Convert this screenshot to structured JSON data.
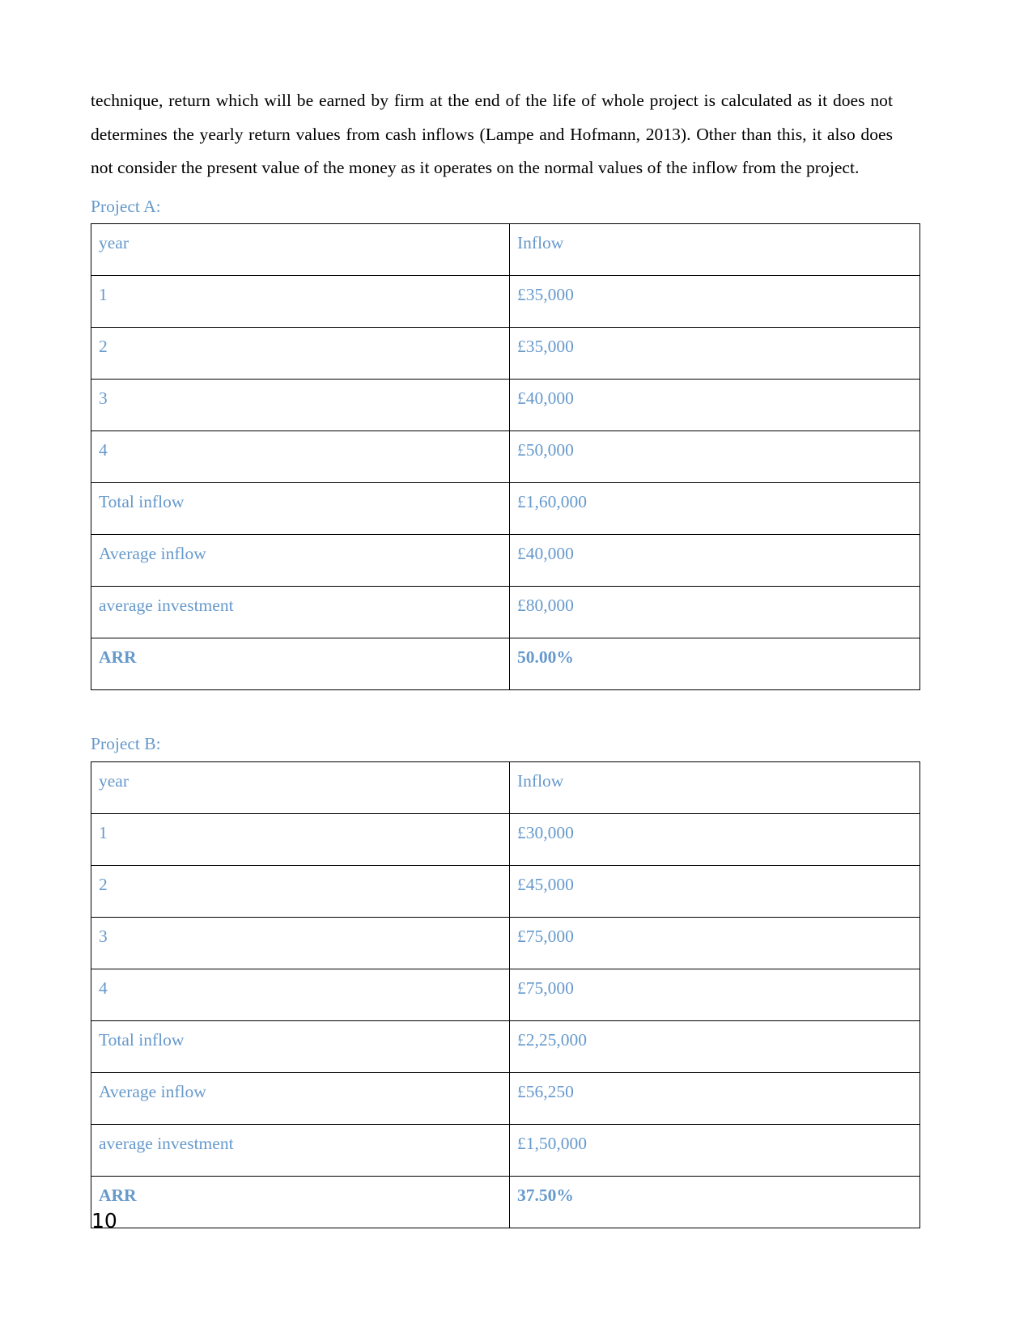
{
  "document": {
    "page_number": "10",
    "accent_color": "#6699cc",
    "body_text_color": "#000000",
    "paragraph": "technique, return which will be earned by firm at the end of the life of whole project is calculated as it does not determines the yearly return values from cash inflows (Lampe and Hofmann, 2013). Other than this, it also does not consider the present value of the money as it operates on the normal values of the inflow from the project."
  },
  "project_a": {
    "caption": "Project A:",
    "table": {
      "columns": [
        "year",
        "Inflow"
      ],
      "rows": [
        {
          "label": "1",
          "value": "£35,000",
          "emphasis": false
        },
        {
          "label": "2",
          "value": "£35,000",
          "emphasis": false
        },
        {
          "label": "3",
          "value": "£40,000",
          "emphasis": false
        },
        {
          "label": "4",
          "value": "£50,000",
          "emphasis": false
        },
        {
          "label": "Total inflow",
          "value": "£1,60,000",
          "emphasis": false
        },
        {
          "label": "Average inflow",
          "value": "£40,000",
          "emphasis": false
        },
        {
          "label": "average investment",
          "value": "£80,000",
          "emphasis": false
        },
        {
          "label": "ARR",
          "value": "50.00%",
          "emphasis": true
        }
      ]
    }
  },
  "project_b": {
    "caption": "Project B:",
    "table": {
      "columns": [
        "year",
        "Inflow"
      ],
      "rows": [
        {
          "label": "1",
          "value": "£30,000",
          "emphasis": false
        },
        {
          "label": "2",
          "value": "£45,000",
          "emphasis": false
        },
        {
          "label": "3",
          "value": "£75,000",
          "emphasis": false
        },
        {
          "label": "4",
          "value": "£75,000",
          "emphasis": false
        },
        {
          "label": "Total inflow",
          "value": "£2,25,000",
          "emphasis": false
        },
        {
          "label": "Average inflow",
          "value": "£56,250",
          "emphasis": false
        },
        {
          "label": "average investment",
          "value": "£1,50,000",
          "emphasis": false
        },
        {
          "label": "ARR",
          "value": "37.50%",
          "emphasis": true
        }
      ]
    }
  }
}
